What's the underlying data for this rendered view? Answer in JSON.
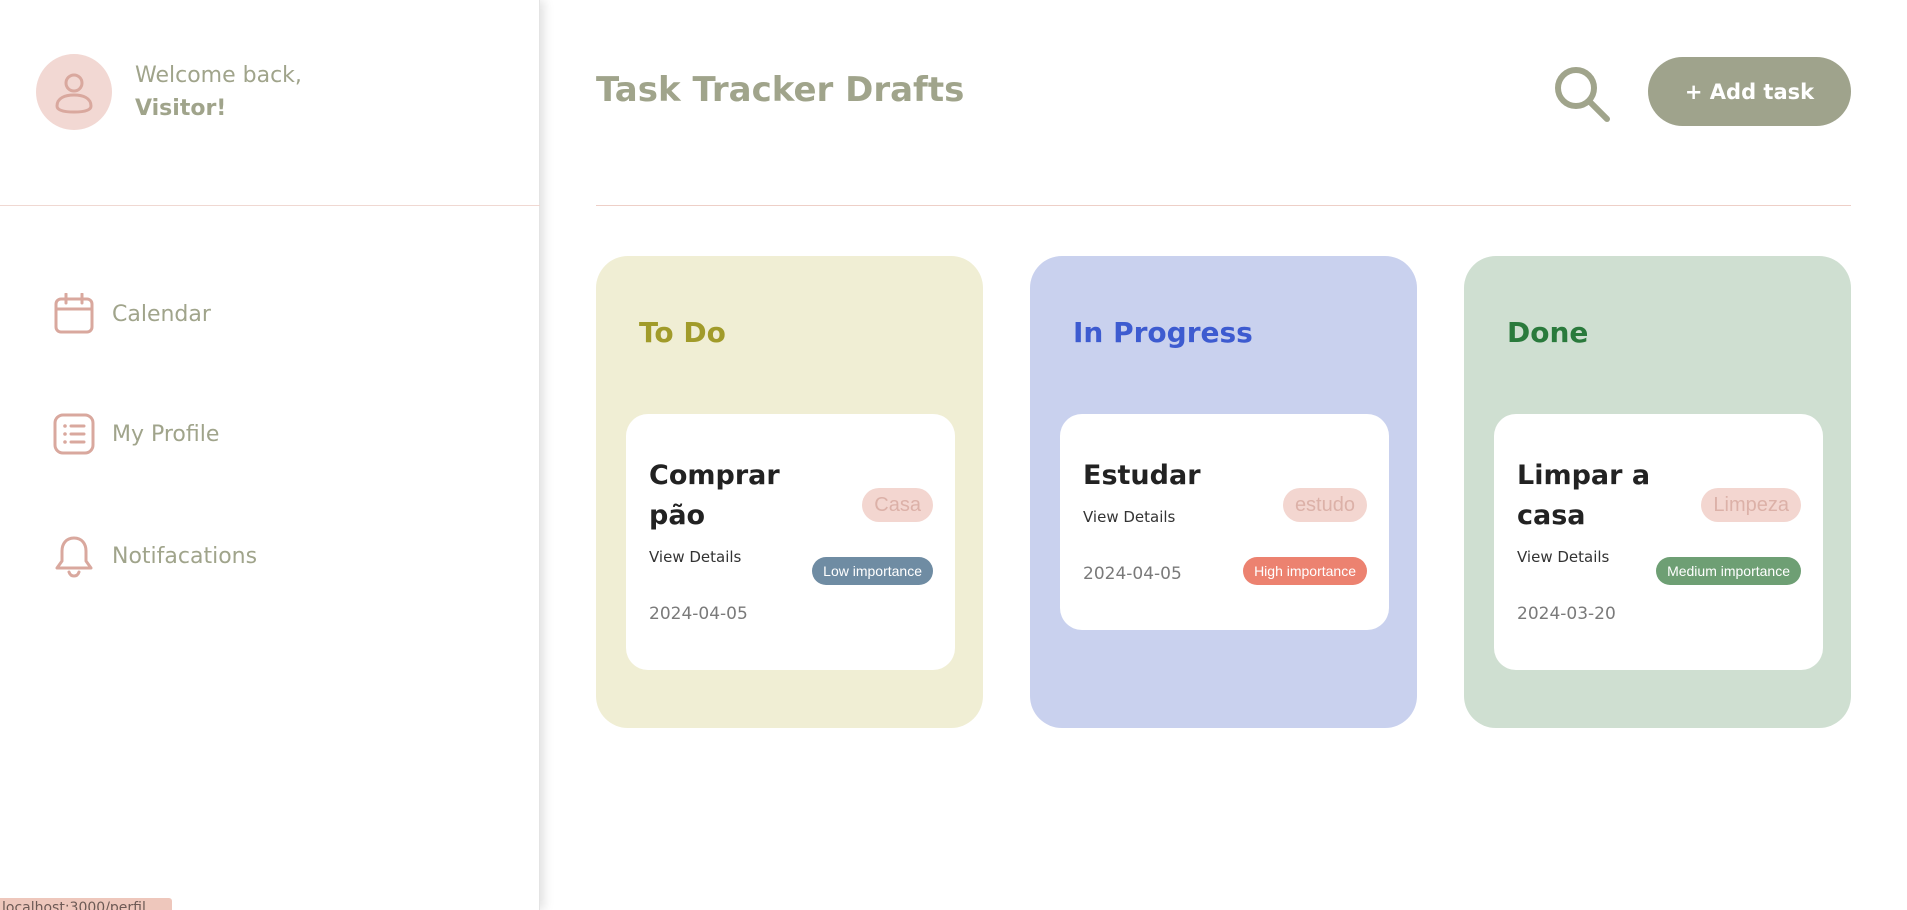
{
  "sidebar": {
    "welcome": "Welcome back,",
    "username": "Visitor!",
    "nav": [
      {
        "label": "Calendar",
        "icon": "calendar-icon"
      },
      {
        "label": "My Profile",
        "icon": "list-icon"
      },
      {
        "label": "Notifacations",
        "icon": "bell-icon"
      }
    ]
  },
  "status_bar": {
    "url": "localhost:3000/perfil"
  },
  "header": {
    "title": "Task Tracker Drafts",
    "search_icon": "search-icon",
    "add_task_label": "+ Add task"
  },
  "columns": [
    {
      "title": "To Do",
      "color": "#a19b2a",
      "background": "#f0eed4",
      "cards": [
        {
          "title": "Comprar pão",
          "tag": "Casa",
          "view_details": "View Details",
          "importance": "Low importance",
          "date": "2024-04-05"
        }
      ]
    },
    {
      "title": "In Progress",
      "color": "#3d5bd0",
      "background": "#c9d1ee",
      "cards": [
        {
          "title": "Estudar",
          "tag": "estudo",
          "view_details": "View Details",
          "importance": "High importance",
          "date": "2024-04-05"
        }
      ]
    },
    {
      "title": "Done",
      "color": "#2a7a3c",
      "background": "#cfdfd1",
      "cards": [
        {
          "title": "Limpar a casa",
          "tag": "Limpeza",
          "view_details": "View Details",
          "importance": "Medium importance",
          "date": "2024-03-20"
        }
      ]
    }
  ],
  "colors": {
    "accent": "#9fa38c",
    "avatar_bg": "#f2d8d3",
    "nav_icon": "#d9a89e",
    "low_importance": "#6f8ca3",
    "high_importance": "#ec8270",
    "medium_importance": "#6e9f74"
  }
}
